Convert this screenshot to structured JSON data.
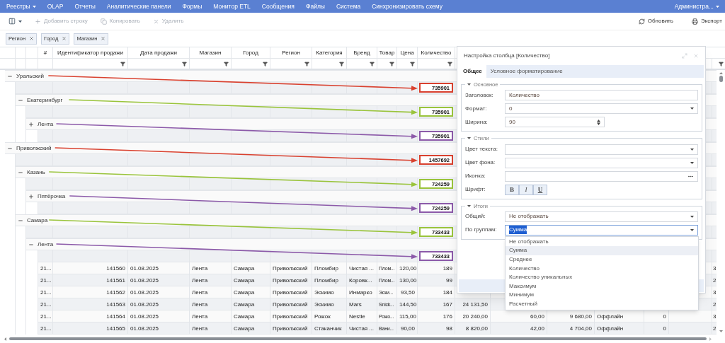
{
  "menu": {
    "items": [
      {
        "label": "Реестры",
        "dropdown": true
      },
      {
        "label": "OLAP",
        "dropdown": false
      },
      {
        "label": "Отчеты",
        "dropdown": false
      },
      {
        "label": "Аналитические панели",
        "dropdown": false
      },
      {
        "label": "Формы",
        "dropdown": false
      },
      {
        "label": "Монитор ETL",
        "dropdown": false
      },
      {
        "label": "Сообщения",
        "dropdown": false
      },
      {
        "label": "Файлы",
        "dropdown": false
      },
      {
        "label": "Система",
        "dropdown": false
      },
      {
        "label": "Синхронизировать схему",
        "dropdown": false
      }
    ],
    "user": {
      "label": "Администра...",
      "dropdown": true
    }
  },
  "toolbar": {
    "left": [
      {
        "kind": "plus",
        "label": "Добавить строку",
        "disabled": true
      },
      {
        "kind": "copy",
        "label": "Копировать",
        "disabled": true
      },
      {
        "kind": "delete",
        "label": "Удалить",
        "disabled": true
      }
    ],
    "right": [
      {
        "kind": "refresh",
        "label": "Обновить",
        "disabled": false
      },
      {
        "kind": "print",
        "label": "Экспорт",
        "disabled": false
      }
    ]
  },
  "group_chips": [
    "Регион",
    "Город",
    "Магазин"
  ],
  "grid": {
    "columns": [
      "#",
      "Идентификатор продажи",
      "Дата продажи",
      "Магазин",
      "Город",
      "Регион",
      "Категория",
      "Бренд",
      "Товар",
      "Цена",
      "Количество"
    ],
    "groups": [
      {
        "label": "Уральский",
        "expanded": true,
        "total": "735901",
        "color": "#d9412f",
        "children": [
          {
            "label": "Екатеринбург",
            "expanded": true,
            "total": "735901",
            "color": "#9ac43c",
            "children": [
              {
                "label": "Лента",
                "expanded": false,
                "total": "735901",
                "color": "#8c5aa9"
              }
            ]
          }
        ]
      },
      {
        "label": "Приволжский",
        "expanded": true,
        "total": "1457692",
        "color": "#d9412f",
        "children": [
          {
            "label": "Казань",
            "expanded": true,
            "total": "724259",
            "color": "#9ac43c",
            "children": [
              {
                "label": "Пятёрочка",
                "expanded": false,
                "total": "724259",
                "color": "#8c5aa9"
              }
            ]
          },
          {
            "label": "Самара",
            "expanded": true,
            "total": "733433",
            "color": "#9ac43c",
            "children": [
              {
                "label": "Лента",
                "expanded": true,
                "total": "733433",
                "color": "#8c5aa9",
                "rows": [
                  {
                    "cells": [
                      "21...",
                      "141560",
                      "01.08.2025",
                      "Лента",
                      "Самара",
                      "Приволжский",
                      "Пломбир",
                      "Чистая ...",
                      "Плом...",
                      "120,00",
                      "189"
                    ],
                    "last": "3"
                  },
                  {
                    "cells": [
                      "21...",
                      "141561",
                      "01.08.2025",
                      "Лента",
                      "Самара",
                      "Приволжский",
                      "Пломбир",
                      "Коровк...",
                      "Плом...",
                      "130,00",
                      "99"
                    ],
                    "last": "2"
                  },
                  {
                    "cells": [
                      "21...",
                      "141562",
                      "01.08.2025",
                      "Лента",
                      "Самара",
                      "Приволжский",
                      "Эскимо",
                      "Инмарко",
                      "Эски...",
                      "93,50",
                      "184"
                    ],
                    "last": "3"
                  },
                  {
                    "cells": [
                      "21...",
                      "141563",
                      "01.08.2025",
                      "Лента",
                      "Самара",
                      "Приволжский",
                      "Эскимо",
                      "Mars",
                      "Snick...",
                      "144,50",
                      "167"
                    ],
                    "extra": [
                      "24 131,50"
                    ],
                    "last": "2"
                  },
                  {
                    "cells": [
                      "21...",
                      "141564",
                      "01.08.2025",
                      "Лента",
                      "Самара",
                      "Приволжский",
                      "Рожок",
                      "Nestle",
                      "Рожо...",
                      "115,00",
                      "176"
                    ],
                    "extra": [
                      "20 240,00",
                      "60,00",
                      "9 680,00",
                      "Оффлайн",
                      "0"
                    ],
                    "last": "3"
                  },
                  {
                    "cells": [
                      "21...",
                      "141565",
                      "01.08.2025",
                      "Лента",
                      "Самара",
                      "Приволжский",
                      "Стаканчик",
                      "Чистая ...",
                      "Вани...",
                      "90,00",
                      "98"
                    ],
                    "extra": [
                      "8 820,00",
                      "42,00",
                      "4 704,00",
                      "Оффлайн",
                      "0"
                    ],
                    "last": "2"
                  }
                ]
              }
            ]
          }
        ]
      }
    ]
  },
  "column_settings": {
    "title": "Настройка столбца [Количество]",
    "tabs": [
      {
        "label": "Общее",
        "selected": true
      },
      {
        "label": "Условное форматирование",
        "selected": false
      }
    ],
    "sections": [
      {
        "title": "Основное",
        "expanded": true,
        "fields": [
          {
            "kind": "text",
            "label": "Заголовок:",
            "value": "Количество"
          },
          {
            "kind": "select",
            "label": "Формат:",
            "value": "0"
          },
          {
            "kind": "spinner",
            "label": "Ширина:",
            "value": "90"
          }
        ]
      },
      {
        "title": "Стили",
        "expanded": true,
        "fields": [
          {
            "kind": "select",
            "label": "Цвет текста:"
          },
          {
            "kind": "select",
            "label": "Цвет фона:"
          },
          {
            "kind": "picker",
            "label": "Иконка:"
          },
          {
            "kind": "font",
            "label": "Шрифт:",
            "buttons": [
              "B",
              "I",
              "U"
            ]
          }
        ]
      },
      {
        "title": "Итоги",
        "expanded": true,
        "fields": [
          {
            "kind": "select",
            "label": "Общий:",
            "value": "Не отображать"
          },
          {
            "kind": "select",
            "label": "По группам:",
            "value": "Сумма",
            "focused": true,
            "options": [
              {
                "label": "Не отображать",
                "selected": false
              },
              {
                "label": "Сумма",
                "selected": true
              },
              {
                "label": "Среднее",
                "selected": false
              },
              {
                "label": "Количество",
                "selected": false
              },
              {
                "label": "Количество уникальных",
                "selected": false
              },
              {
                "label": "Максимум",
                "selected": false
              },
              {
                "label": "Минимум",
                "selected": false
              },
              {
                "label": "Расчетный",
                "selected": false
              }
            ]
          }
        ]
      }
    ]
  }
}
